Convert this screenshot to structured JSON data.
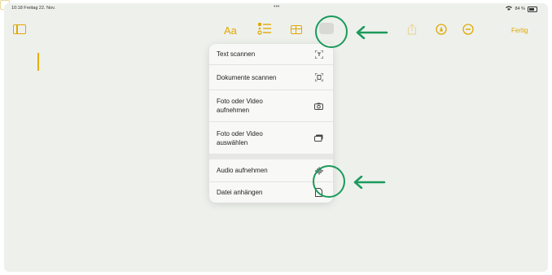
{
  "status_bar": {
    "time_date": "10:18  Freitag 22. Nov.",
    "center_dots": "•••",
    "battery": "84 %"
  },
  "toolbar": {
    "format_label": "Aa",
    "done_label": "Fertig"
  },
  "menu": {
    "items": [
      {
        "label": "Text scannen",
        "icon": "text-scan-icon"
      },
      {
        "label": "Dokumente scannen",
        "icon": "doc-scan-icon"
      },
      {
        "label": "Foto oder Video aufnehmen",
        "icon": "camera-icon"
      },
      {
        "label": "Foto oder Video auswählen",
        "icon": "photo-library-icon"
      },
      {
        "label": "Audio aufnehmen",
        "icon": "waveform-icon"
      },
      {
        "label": "Datei anhängen",
        "icon": "file-icon"
      }
    ]
  },
  "colors": {
    "accent": "#e1a800",
    "annotation": "#1a9a5b",
    "background": "#eef0ec"
  }
}
